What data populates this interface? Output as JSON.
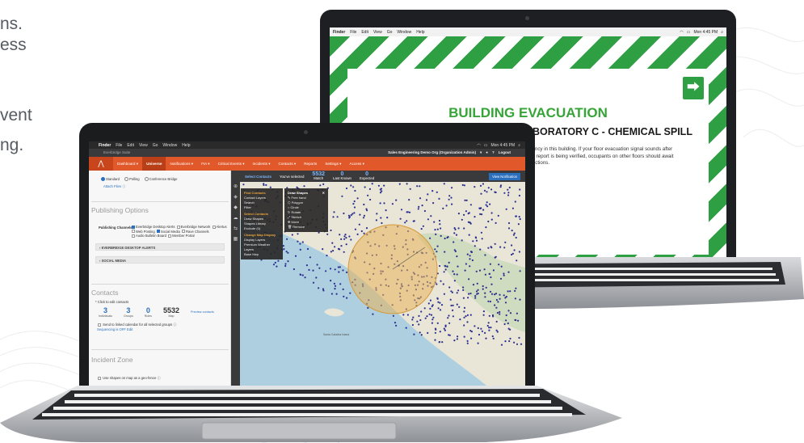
{
  "background_text": [
    "ns.",
    "ess",
    "vent",
    "ng."
  ],
  "back_laptop": {
    "menubar": {
      "items": [
        "Finder",
        "File",
        "Edit",
        "View",
        "Go",
        "Window",
        "Help"
      ],
      "clock": "Mon 4:45 PM"
    },
    "title": "BUILDING EVACUATION",
    "exit_icon": "emergency-exit-icon",
    "subtitle": "ABORATORY C - CHEMICAL SPILL",
    "body_lines": [
      "gency in this building. If your floor evacuation signal sounds after",
      "he report is being verified, occupants on other floors should await",
      "tructions."
    ],
    "colors": {
      "stripe_green": "#2ea043",
      "title_green": "#36a537"
    }
  },
  "front_laptop": {
    "menubar": {
      "items": [
        "Finder",
        "File",
        "Edit",
        "View",
        "Go",
        "Window",
        "Help"
      ],
      "clock": "Mon 4:45 PM"
    },
    "app_name": "Everbridge Suite",
    "org": "Sales Engineering Demo Org (Organization Admin)",
    "logout": "Logout",
    "nav": [
      "Dashboard ▾",
      "Universe",
      "Notifications ▾",
      "FIA ▾",
      "Critical Events ▾",
      "Incidents ▾",
      "Contacts ▾",
      "Reports",
      "Settings ▾",
      "Access ▾"
    ],
    "modes": [
      "Standard",
      "Polling",
      "Conference Bridge"
    ],
    "attach_files": "Attach Files",
    "publishing": {
      "heading": "Publishing Options",
      "label": "Publishing Channels:",
      "channels": [
        {
          "name": "Everbridge Desktop Alerts",
          "checked": true
        },
        {
          "name": "Everbridge Network",
          "checked": false
        },
        {
          "name": "Alertus",
          "checked": false
        },
        {
          "name": "Web Posting",
          "checked": false
        },
        {
          "name": "Social Media",
          "checked": true
        },
        {
          "name": "Rave Channels",
          "checked": false
        },
        {
          "name": "Audio Bulletin Board",
          "checked": false
        },
        {
          "name": "Member Portal",
          "checked": false
        }
      ],
      "sections": [
        "EVERBRIDGE DESKTOP ALERTS",
        "SOCIAL MEDIA"
      ]
    },
    "contacts": {
      "heading": "Contacts",
      "hint": "* Click to edit contacts",
      "counts": [
        {
          "value": "3",
          "label": "Individuals"
        },
        {
          "value": "3",
          "label": "Groups"
        },
        {
          "value": "0",
          "label": "Rules"
        },
        {
          "value": "5532",
          "label": "Map"
        }
      ],
      "preview": "Preview contacts",
      "calendar_text": "Send to linked calendar for all selected groups",
      "sequencing": "Sequencing is OFF Edit"
    },
    "incident_zone": {
      "heading": "Incident Zone",
      "geofence": "Use shapes on map as a geo-fence"
    },
    "map": {
      "tabs": [
        "Select Contacts",
        "You've selected"
      ],
      "stats": [
        {
          "value": "5532",
          "label": "Match"
        },
        {
          "value": "0",
          "label": "Last Known"
        },
        {
          "value": "0",
          "label": "Expected"
        }
      ],
      "view_button": "View Notification",
      "menu_main": {
        "groups": [
          {
            "heading": "Find Contacts",
            "items": [
              "Contact Layers",
              "Search",
              "Filter"
            ]
          },
          {
            "heading": "Select Contacts",
            "items": [
              "Draw Shapes",
              "Shapes Library",
              "Exclude (0)"
            ]
          },
          {
            "heading": "Change Map Display",
            "items": [
              "Display Layers",
              "Premium Weather Layers",
              "Base Map"
            ]
          }
        ]
      },
      "menu_shapes": {
        "title": "Draw Shapes",
        "items": [
          "Free hand",
          "Polygon",
          "Circle",
          "Rotate",
          "Stretch",
          "Move",
          "Remove"
        ]
      },
      "island_label": "Santa Catalina Island",
      "attribution": "Map data ©2017 Google, INEGI  Terms of Use  Report a map error",
      "google": "Google"
    },
    "colors": {
      "nav_orange": "#e1582a",
      "link_blue": "#2a6fbe",
      "zone_fill": "#e7b35a",
      "dot_blue": "#2b2f8f"
    }
  }
}
